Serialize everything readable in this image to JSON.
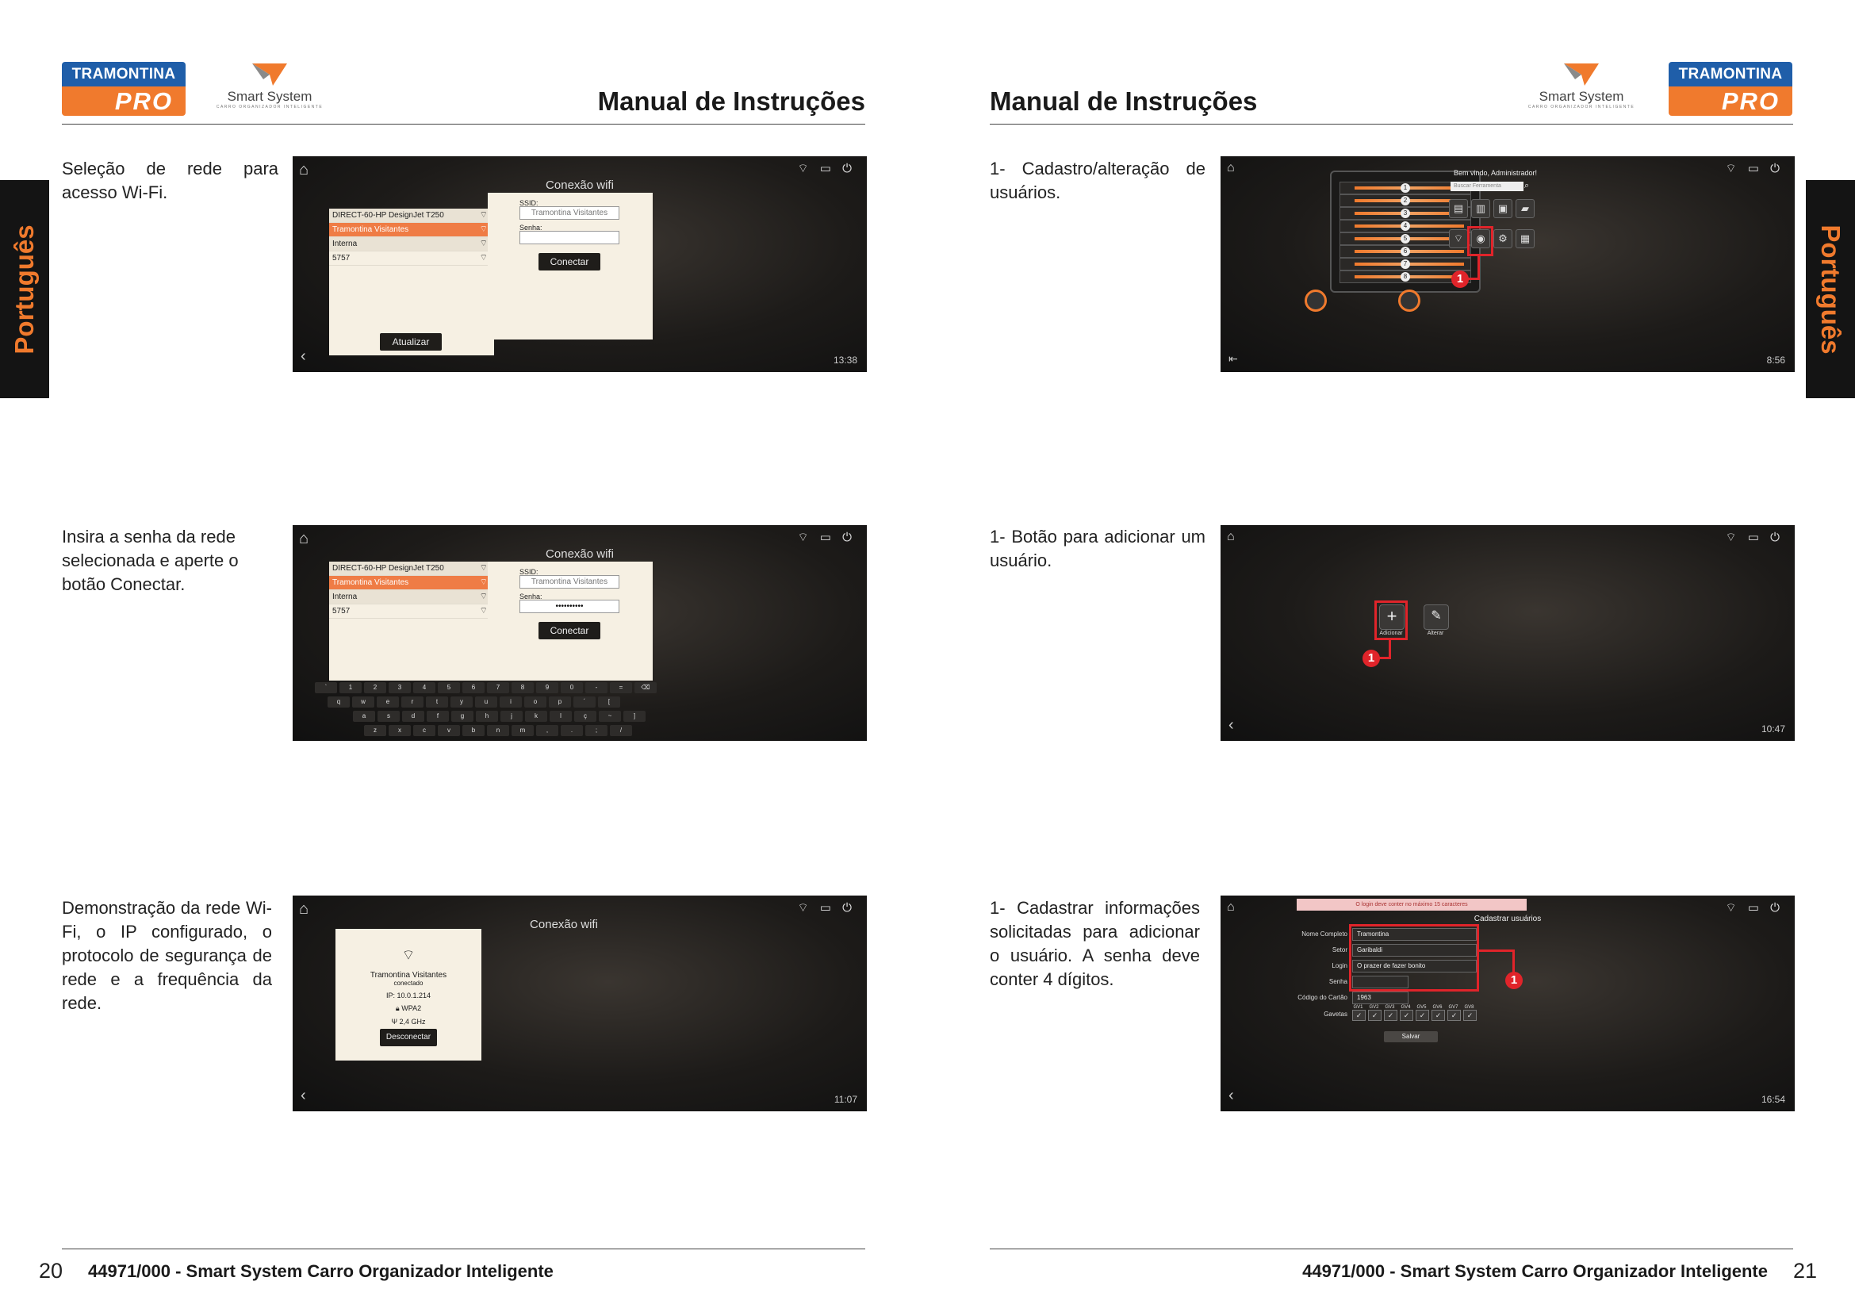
{
  "brand": {
    "badge_top": "TRAMONTINA",
    "badge_bottom": "PRO",
    "smart_name": "Smart System",
    "smart_sub": "CARRO ORGANIZADOR INTELIGENTE"
  },
  "header": {
    "title": "Manual de Instruções"
  },
  "side_tab": "Português",
  "left": {
    "steps": [
      {
        "text": "Seleção de rede para acesso Wi-Fi."
      },
      {
        "text": "Insira a senha da rede selecionada e aperte o botão Conectar."
      },
      {
        "text": "Demonstração da rede Wi-Fi, o IP configurado, o protocolo de segurança de rede e a frequência da rede."
      }
    ],
    "page_number": "20"
  },
  "right": {
    "steps": [
      {
        "text": "1- Cadastro/alteração de usuários."
      },
      {
        "text": "1- Botão para adicionar um usuário."
      },
      {
        "text": "1- Cadastrar informações solicitadas para adicionar o usuário. A senha deve conter 4 dígitos."
      }
    ],
    "page_number": "21"
  },
  "footer": {
    "text": "44971/000 - Smart System Carro Organizador Inteligente"
  },
  "screens": {
    "wifi_title": "Conexão wifi",
    "networks": [
      "DIRECT-60-HP DesignJet T250",
      "Tramontina Visitantes",
      "Interna",
      "5757"
    ],
    "ssid_label": "SSID:",
    "ssid_value": "Tramontina Visitantes",
    "senha_label": "Senha:",
    "password_mask": "••••••••••",
    "connect_button": "Conectar",
    "refresh_button": "Atualizar",
    "time1": "13:38",
    "time2": "",
    "time3": "11:07",
    "status_network": "Tramontina Visitantes",
    "status_connected": "conectado",
    "status_ip": "IP: 10.0.1.214",
    "status_security": "WPA2",
    "status_freq": "2,4 GHz",
    "disconnect_button": "Desconectar",
    "keyboard_rows": [
      [
        "`",
        "1",
        "2",
        "3",
        "4",
        "5",
        "6",
        "7",
        "8",
        "9",
        "0",
        "-",
        "=",
        "⌫"
      ],
      [
        "q",
        "w",
        "e",
        "r",
        "t",
        "y",
        "u",
        "i",
        "o",
        "p",
        "´",
        "["
      ],
      [
        "a",
        "s",
        "d",
        "f",
        "g",
        "h",
        "j",
        "k",
        "l",
        "ç",
        "~",
        "]"
      ],
      [
        "z",
        "x",
        "c",
        "v",
        "b",
        "n",
        "m",
        ",",
        ".",
        ";",
        "/"
      ]
    ],
    "welcome": "Bem vindo, Administrador!",
    "search_placeholder": "Buscar Ferramenta",
    "time4": "8:56",
    "add_label": "Adicionar",
    "edit_label": "Alterar",
    "time5": "10:47",
    "warning": "O login deve conter no máximo 15 caracteres",
    "register_title": "Cadastrar usuários",
    "form": {
      "nome_label": "Nome Completo",
      "nome_value": "Tramontina",
      "setor_label": "Setor",
      "setor_value": "Garibaldi",
      "login_label": "Login",
      "login_value": "O prazer de fazer bonito",
      "senha_label": "Senha",
      "senha_value": "",
      "cartao_label": "Código do Cartão",
      "cartao_value": "1963",
      "gavetas_label": "Gavetas",
      "drawers": [
        "GV1",
        "GV2",
        "GV3",
        "GV4",
        "GV5",
        "GV6",
        "GV7",
        "GV8"
      ],
      "save_button": "Salvar"
    },
    "time6": "16:54",
    "marker": "1"
  },
  "colors": {
    "brand_blue": "#1f5ea9",
    "brand_orange": "#f07a2d",
    "highlight_red": "#e0242a"
  }
}
